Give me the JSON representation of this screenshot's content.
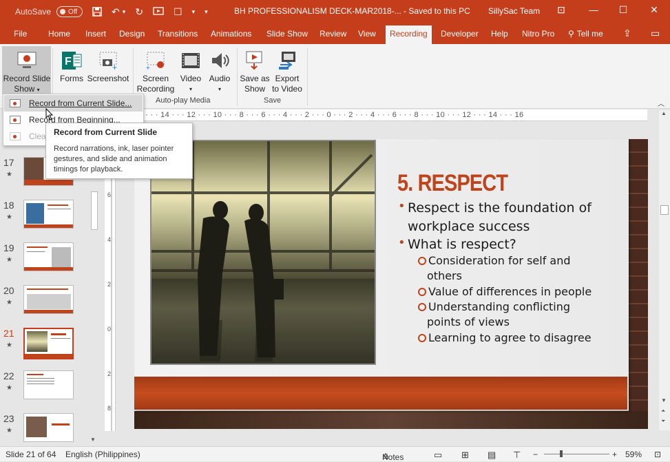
{
  "titlebar": {
    "autosave_label": "AutoSave",
    "autosave_state": "Off",
    "document_title": "BH PROFESSIONALISM DECK-MAR2018-...  -  Saved to this PC",
    "user": "SillySac Team"
  },
  "tabs": [
    "File",
    "Home",
    "Insert",
    "Design",
    "Transitions",
    "Animations",
    "Slide Show",
    "Review",
    "View",
    "Recording",
    "Developer",
    "Help",
    "Nitro Pro",
    "Tell me"
  ],
  "active_tab": "Recording",
  "ribbon": {
    "record_slide_show": {
      "line1": "Record Slide",
      "line2": "Show"
    },
    "forms": "Forms",
    "screenshot": "Screenshot",
    "screen_recording": {
      "line1": "Screen",
      "line2": "Recording"
    },
    "video": "Video",
    "audio": "Audio",
    "save_as_show": {
      "line1": "Save as",
      "line2": "Show"
    },
    "export_to_video": {
      "line1": "Export",
      "line2": "to Video"
    },
    "groups": {
      "auto_play_media": "Auto-play Media",
      "save": "Save"
    }
  },
  "dropdown": {
    "items": [
      "Record from Current Slide...",
      "Record from Beginning...",
      "Clear"
    ]
  },
  "tooltip": {
    "title": "Record from Current Slide",
    "body": "Record narrations, ink, laser pointer gestures, and slide and animation timings for playback."
  },
  "thumbnails": [
    {
      "num": "17",
      "active": false
    },
    {
      "num": "18",
      "active": false
    },
    {
      "num": "19",
      "active": false
    },
    {
      "num": "20",
      "active": false
    },
    {
      "num": "21",
      "active": true
    },
    {
      "num": "22",
      "active": false
    },
    {
      "num": "23",
      "active": false
    }
  ],
  "ruler_labels": "16 · · · 14 · · · 12 · · · 10 · · · 8 · · · 6 · · · 4 · · · 2 · · · 0 · · · 2 · · · 4 · · · 6 · · · 8 · · · 10 · · · 12 · · · 14 · · · 16",
  "slide": {
    "title": "5. RESPECT",
    "bullets": [
      {
        "level": 1,
        "text": "Respect is the foundation of"
      },
      {
        "level": 1,
        "text": "workplace success"
      },
      {
        "level": 1,
        "text": "What is respect?"
      },
      {
        "level": 2,
        "text": "Consideration for self and"
      },
      {
        "level": 2,
        "text": "others"
      },
      {
        "level": 2,
        "text": "Value of differences in people"
      },
      {
        "level": 2,
        "text": "Understanding conflicting"
      },
      {
        "level": 2,
        "text": "points of views"
      },
      {
        "level": 2,
        "text": "Learning to agree to disagree"
      }
    ]
  },
  "status": {
    "slide_info": "Slide 21 of 64",
    "language": "English (Philippines)",
    "notes": "Notes",
    "zoom": "59%"
  },
  "colors": {
    "accent": "#c43e1c",
    "title_red": "#c0441b"
  }
}
